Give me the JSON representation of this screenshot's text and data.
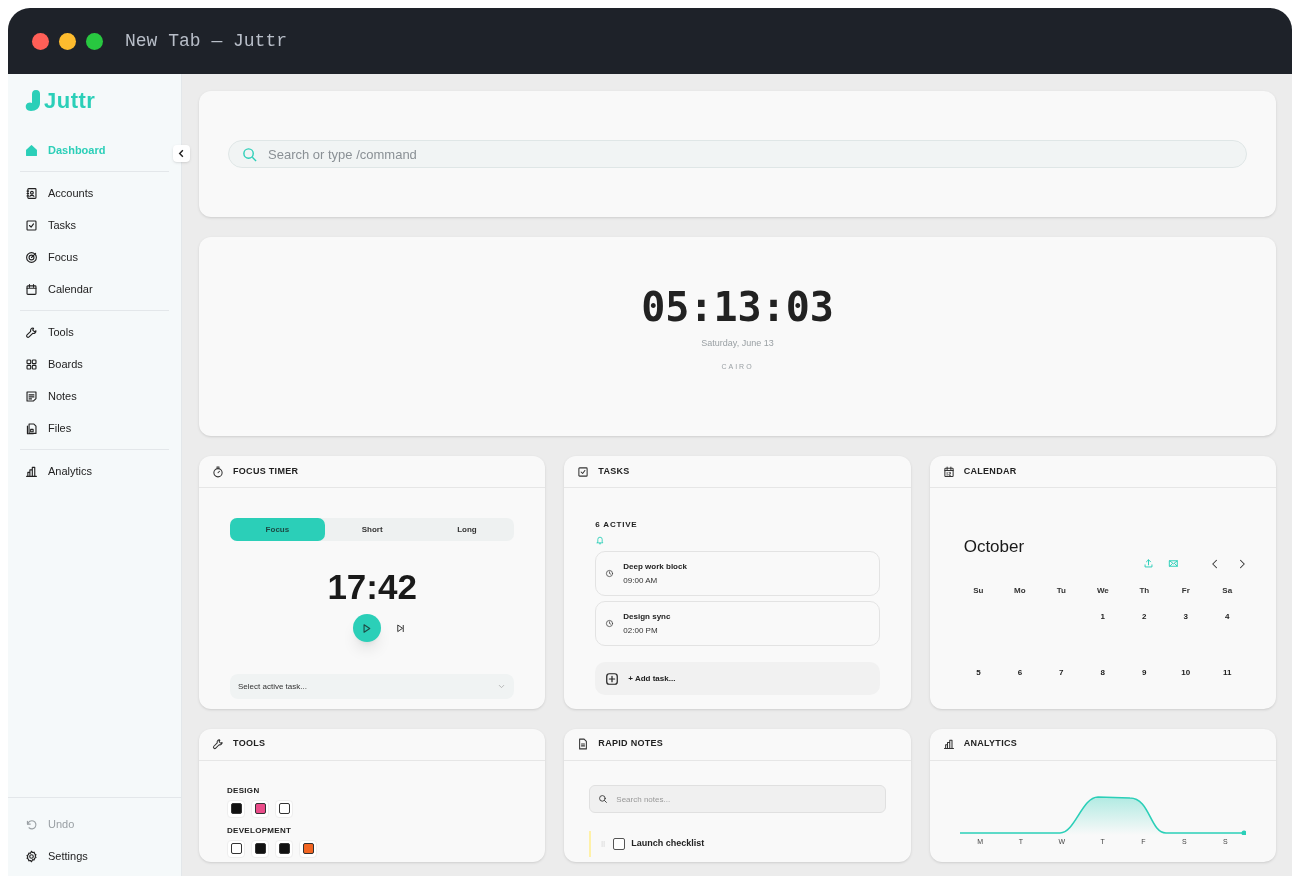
{
  "window": {
    "title": "New Tab — Juttr"
  },
  "sidebar": {
    "logo": "Juttr",
    "sections": [
      [
        {
          "label": "Dashboard",
          "selected": true
        }
      ],
      [
        {
          "label": "Accounts",
          "selected": false
        },
        {
          "label": "Tasks",
          "selected": false
        },
        {
          "label": "Focus",
          "selected": false
        },
        {
          "label": "Calendar",
          "selected": false
        }
      ],
      [
        {
          "label": "Tools",
          "selected": false
        },
        {
          "label": "Boards",
          "selected": false
        },
        {
          "label": "Notes",
          "selected": false
        },
        {
          "label": "Files",
          "selected": false
        }
      ],
      [
        {
          "label": "Analytics",
          "selected": false
        }
      ]
    ],
    "footer": [
      {
        "label": "Undo",
        "disabled": true
      },
      {
        "label": "Settings",
        "disabled": false
      }
    ]
  },
  "search": {
    "placeholder": "Search or type /command"
  },
  "clock": {
    "time": "05:13:03",
    "date": "Saturday, June 13",
    "city": "CAIRO"
  },
  "focus_timer": {
    "title": "FOCUS TIMER",
    "modes": [
      {
        "label": "Focus",
        "selected": true
      },
      {
        "label": "Short",
        "selected": false
      },
      {
        "label": "Long",
        "selected": false
      }
    ],
    "time": "17:42",
    "task_select": "Select active task..."
  },
  "tasks": {
    "title": "TASKS",
    "count": "6 ACTIVE",
    "items": [
      {
        "title": "Deep work block",
        "time": "09:00 AM"
      },
      {
        "title": "Design sync",
        "time": "02:00 PM"
      }
    ],
    "add": "+ Add task..."
  },
  "calendar": {
    "title": "CALENDAR",
    "month": "October",
    "weekdays": [
      "Su",
      "Mo",
      "Tu",
      "We",
      "Th",
      "Fr",
      "Sa"
    ],
    "weeks": [
      [
        "1",
        "2",
        "3",
        "4"
      ],
      [
        "5",
        "6",
        "7",
        "8",
        "9",
        "10",
        "11"
      ]
    ]
  },
  "tools": {
    "title": "TOOLS",
    "groups": [
      {
        "label": "DESIGN",
        "apps": [
          {
            "color": "#111111"
          },
          {
            "color": "#ea4c89"
          },
          {
            "color": "#ffffff"
          }
        ]
      },
      {
        "label": "DEVELOPMENT",
        "apps": [
          {
            "color": "#ffffff"
          },
          {
            "color": "#111111"
          },
          {
            "color": "#111111"
          },
          {
            "color": "#f26522"
          }
        ]
      }
    ]
  },
  "rapid_notes": {
    "title": "RAPID NOTES",
    "search_placeholder": "Search notes...",
    "notes": [
      {
        "title": "Launch checklist",
        "checked": false
      }
    ]
  },
  "analytics": {
    "title": "ANALYTICS",
    "days": [
      "M",
      "T",
      "W",
      "T",
      "F",
      "S",
      "S"
    ]
  }
}
